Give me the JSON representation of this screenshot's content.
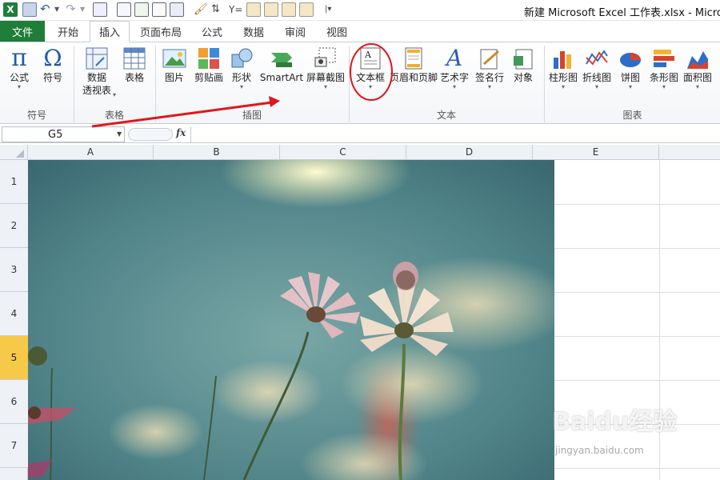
{
  "titlebar": {
    "title": "新建 Microsoft Excel 工作表.xlsx  -  Microsof"
  },
  "tabs": {
    "file": "文件",
    "items": [
      "开始",
      "插入",
      "页面布局",
      "公式",
      "数据",
      "审阅",
      "视图"
    ],
    "active": "插入"
  },
  "ribbon": {
    "groups": {
      "symbols": "符号",
      "tables": "表格",
      "illustrations": "插图",
      "text": "文本",
      "charts": "图表"
    },
    "buttons": {
      "formula": "公式",
      "symbol": "符号",
      "pivot_line1": "数据",
      "pivot_line2": "透视表",
      "table": "表格",
      "picture": "图片",
      "clipart": "剪贴画",
      "shapes": "形状",
      "smartart": "SmartArt",
      "screenshot": "屏幕截图",
      "textbox": "文本框",
      "header_footer": "页眉和页脚",
      "wordart": "艺术字",
      "signature": "签名行",
      "object": "对象",
      "column_chart": "柱形图",
      "line_chart": "折线图",
      "pie_chart": "饼图",
      "bar_chart": "条形图",
      "area_chart": "面积图"
    }
  },
  "formula_bar": {
    "cell_ref": "G5",
    "fx": "fx",
    "content": ""
  },
  "grid": {
    "columns": [
      "A",
      "B",
      "C",
      "D",
      "E"
    ],
    "rows": [
      "1",
      "2",
      "3",
      "4",
      "5",
      "6",
      "7"
    ],
    "selected_row": "5"
  },
  "watermark": {
    "brand": "Baidu经验",
    "url": "jingyan.baidu.com"
  },
  "colors": {
    "file_tab": "#1f7e3a",
    "annotation": "#e0161b",
    "selected_row_header": "#f7c948"
  }
}
